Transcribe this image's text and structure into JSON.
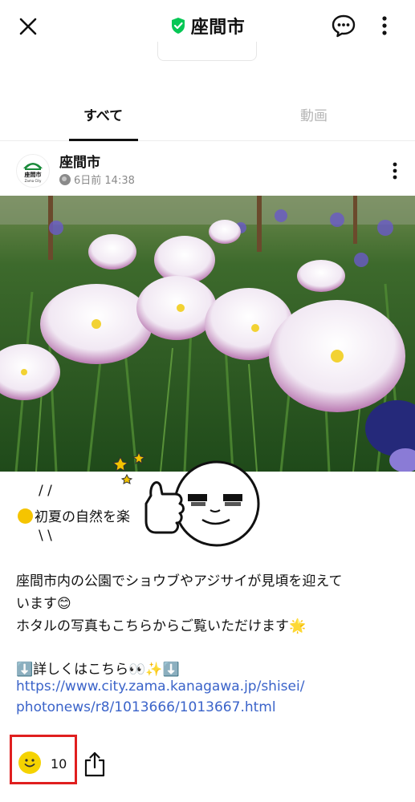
{
  "header": {
    "title": "座間市",
    "icons": {
      "close": "close-icon",
      "verified": "shield-check-icon",
      "chat": "chat-bubble-icon",
      "more": "more-vertical-icon"
    },
    "accent_color": "#06c755"
  },
  "tabs": [
    {
      "label": "すべて",
      "active": true
    },
    {
      "label": "動画",
      "active": false
    }
  ],
  "post": {
    "author": "座間市",
    "avatar_text": "座間市",
    "avatar_sub": "Zama City",
    "time": "6日前 14:38",
    "lines": {
      "deco_top": "/ /",
      "headline": "初夏の自然を楽",
      "deco_bottom": "\\ \\",
      "body1": "座間市内の公園でショウブやアジサイが見頃を迎えて",
      "body2": "います😊",
      "body3": "ホタルの写真もこちらからご覧いただけます🌟",
      "details": "⬇️詳しくはこちら👀✨⬇️",
      "link1": "https://www.city.zama.kanagawa.jp/shisei/",
      "link2": "photonews/r8/1013666/1013667.html"
    }
  },
  "footer": {
    "reaction_count": "10",
    "icons": {
      "reaction": "smiley-icon",
      "share": "share-icon"
    },
    "highlight_color": "#e01f1f"
  }
}
